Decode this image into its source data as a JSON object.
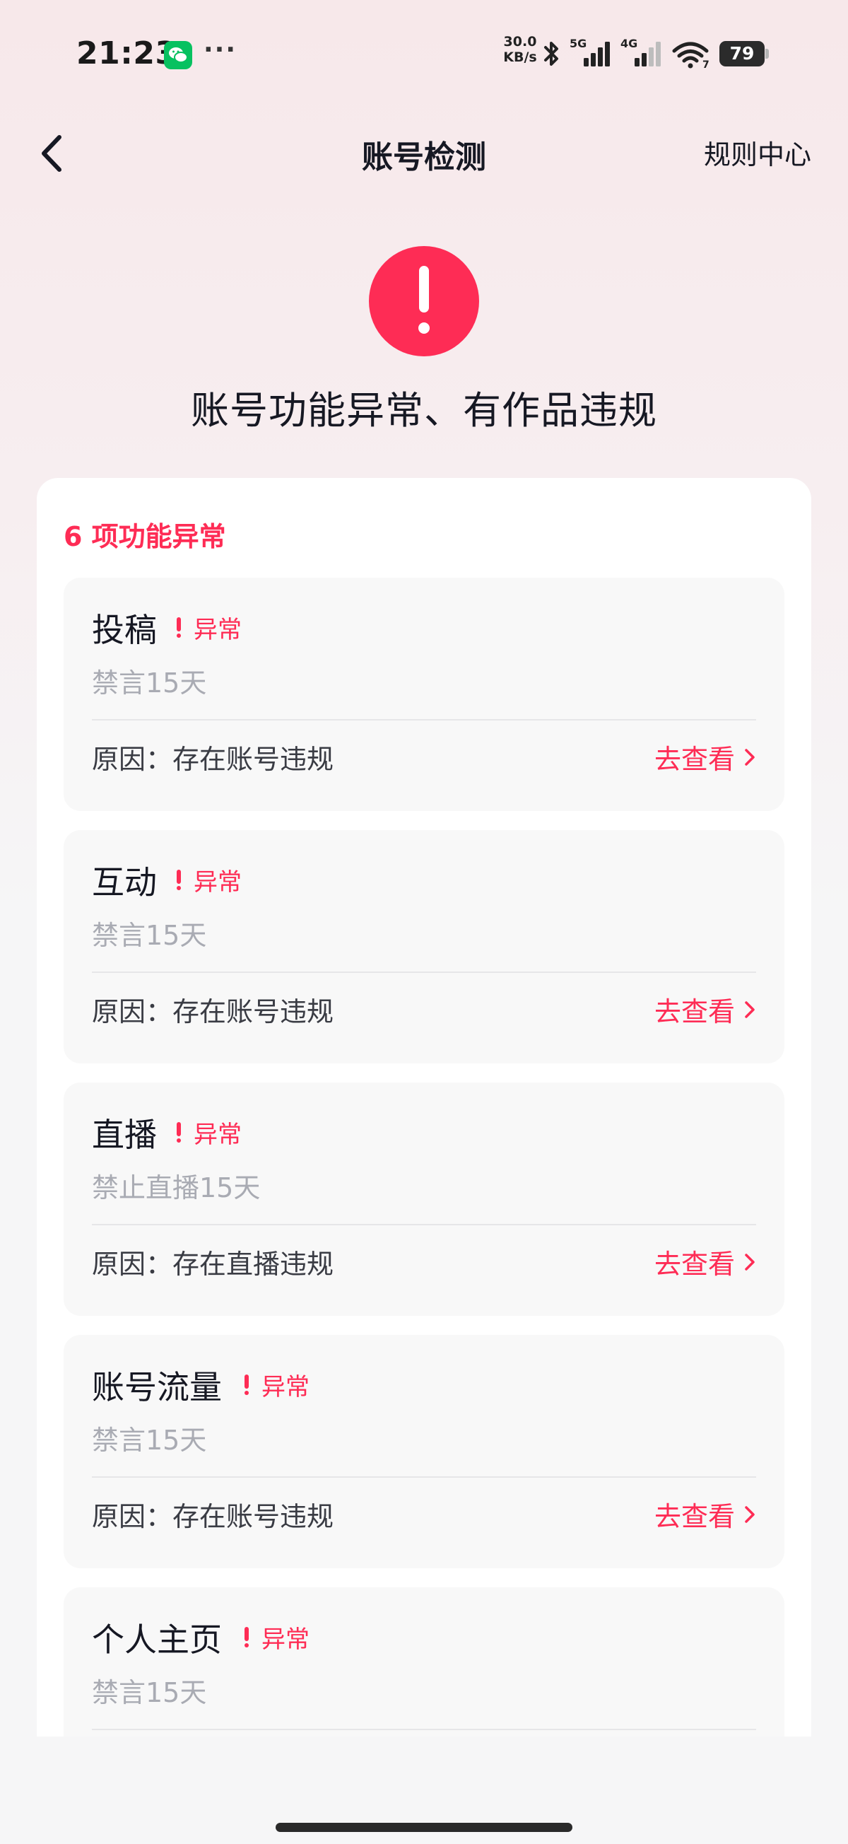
{
  "status_bar": {
    "time": "21:23",
    "speed_value": "30.0",
    "speed_unit": "KB/s",
    "sim1_label": "5G",
    "sim2_label": "4G",
    "wifi_label": "7",
    "battery": "79"
  },
  "nav": {
    "title": "账号检测",
    "rules_link": "规则中心"
  },
  "hero": {
    "status_text": "账号功能异常、有作品违规"
  },
  "card": {
    "heading": "6 项功能异常",
    "badge_label": "异常",
    "link_label": "去查看",
    "items": [
      {
        "name": "投稿",
        "sub": "禁言15天",
        "reason": "原因：存在账号违规"
      },
      {
        "name": "互动",
        "sub": "禁言15天",
        "reason": "原因：存在账号违规"
      },
      {
        "name": "直播",
        "sub": "禁止直播15天",
        "reason": "原因：存在直播违规"
      },
      {
        "name": "账号流量",
        "sub": "禁言15天",
        "reason": "原因：存在账号违规"
      },
      {
        "name": "个人主页",
        "sub": "禁言15天",
        "reason": ""
      }
    ]
  },
  "colors": {
    "accent": "#fe2c55",
    "muted_text": "#a9abb3",
    "card_item_bg": "#f8f8f8"
  }
}
